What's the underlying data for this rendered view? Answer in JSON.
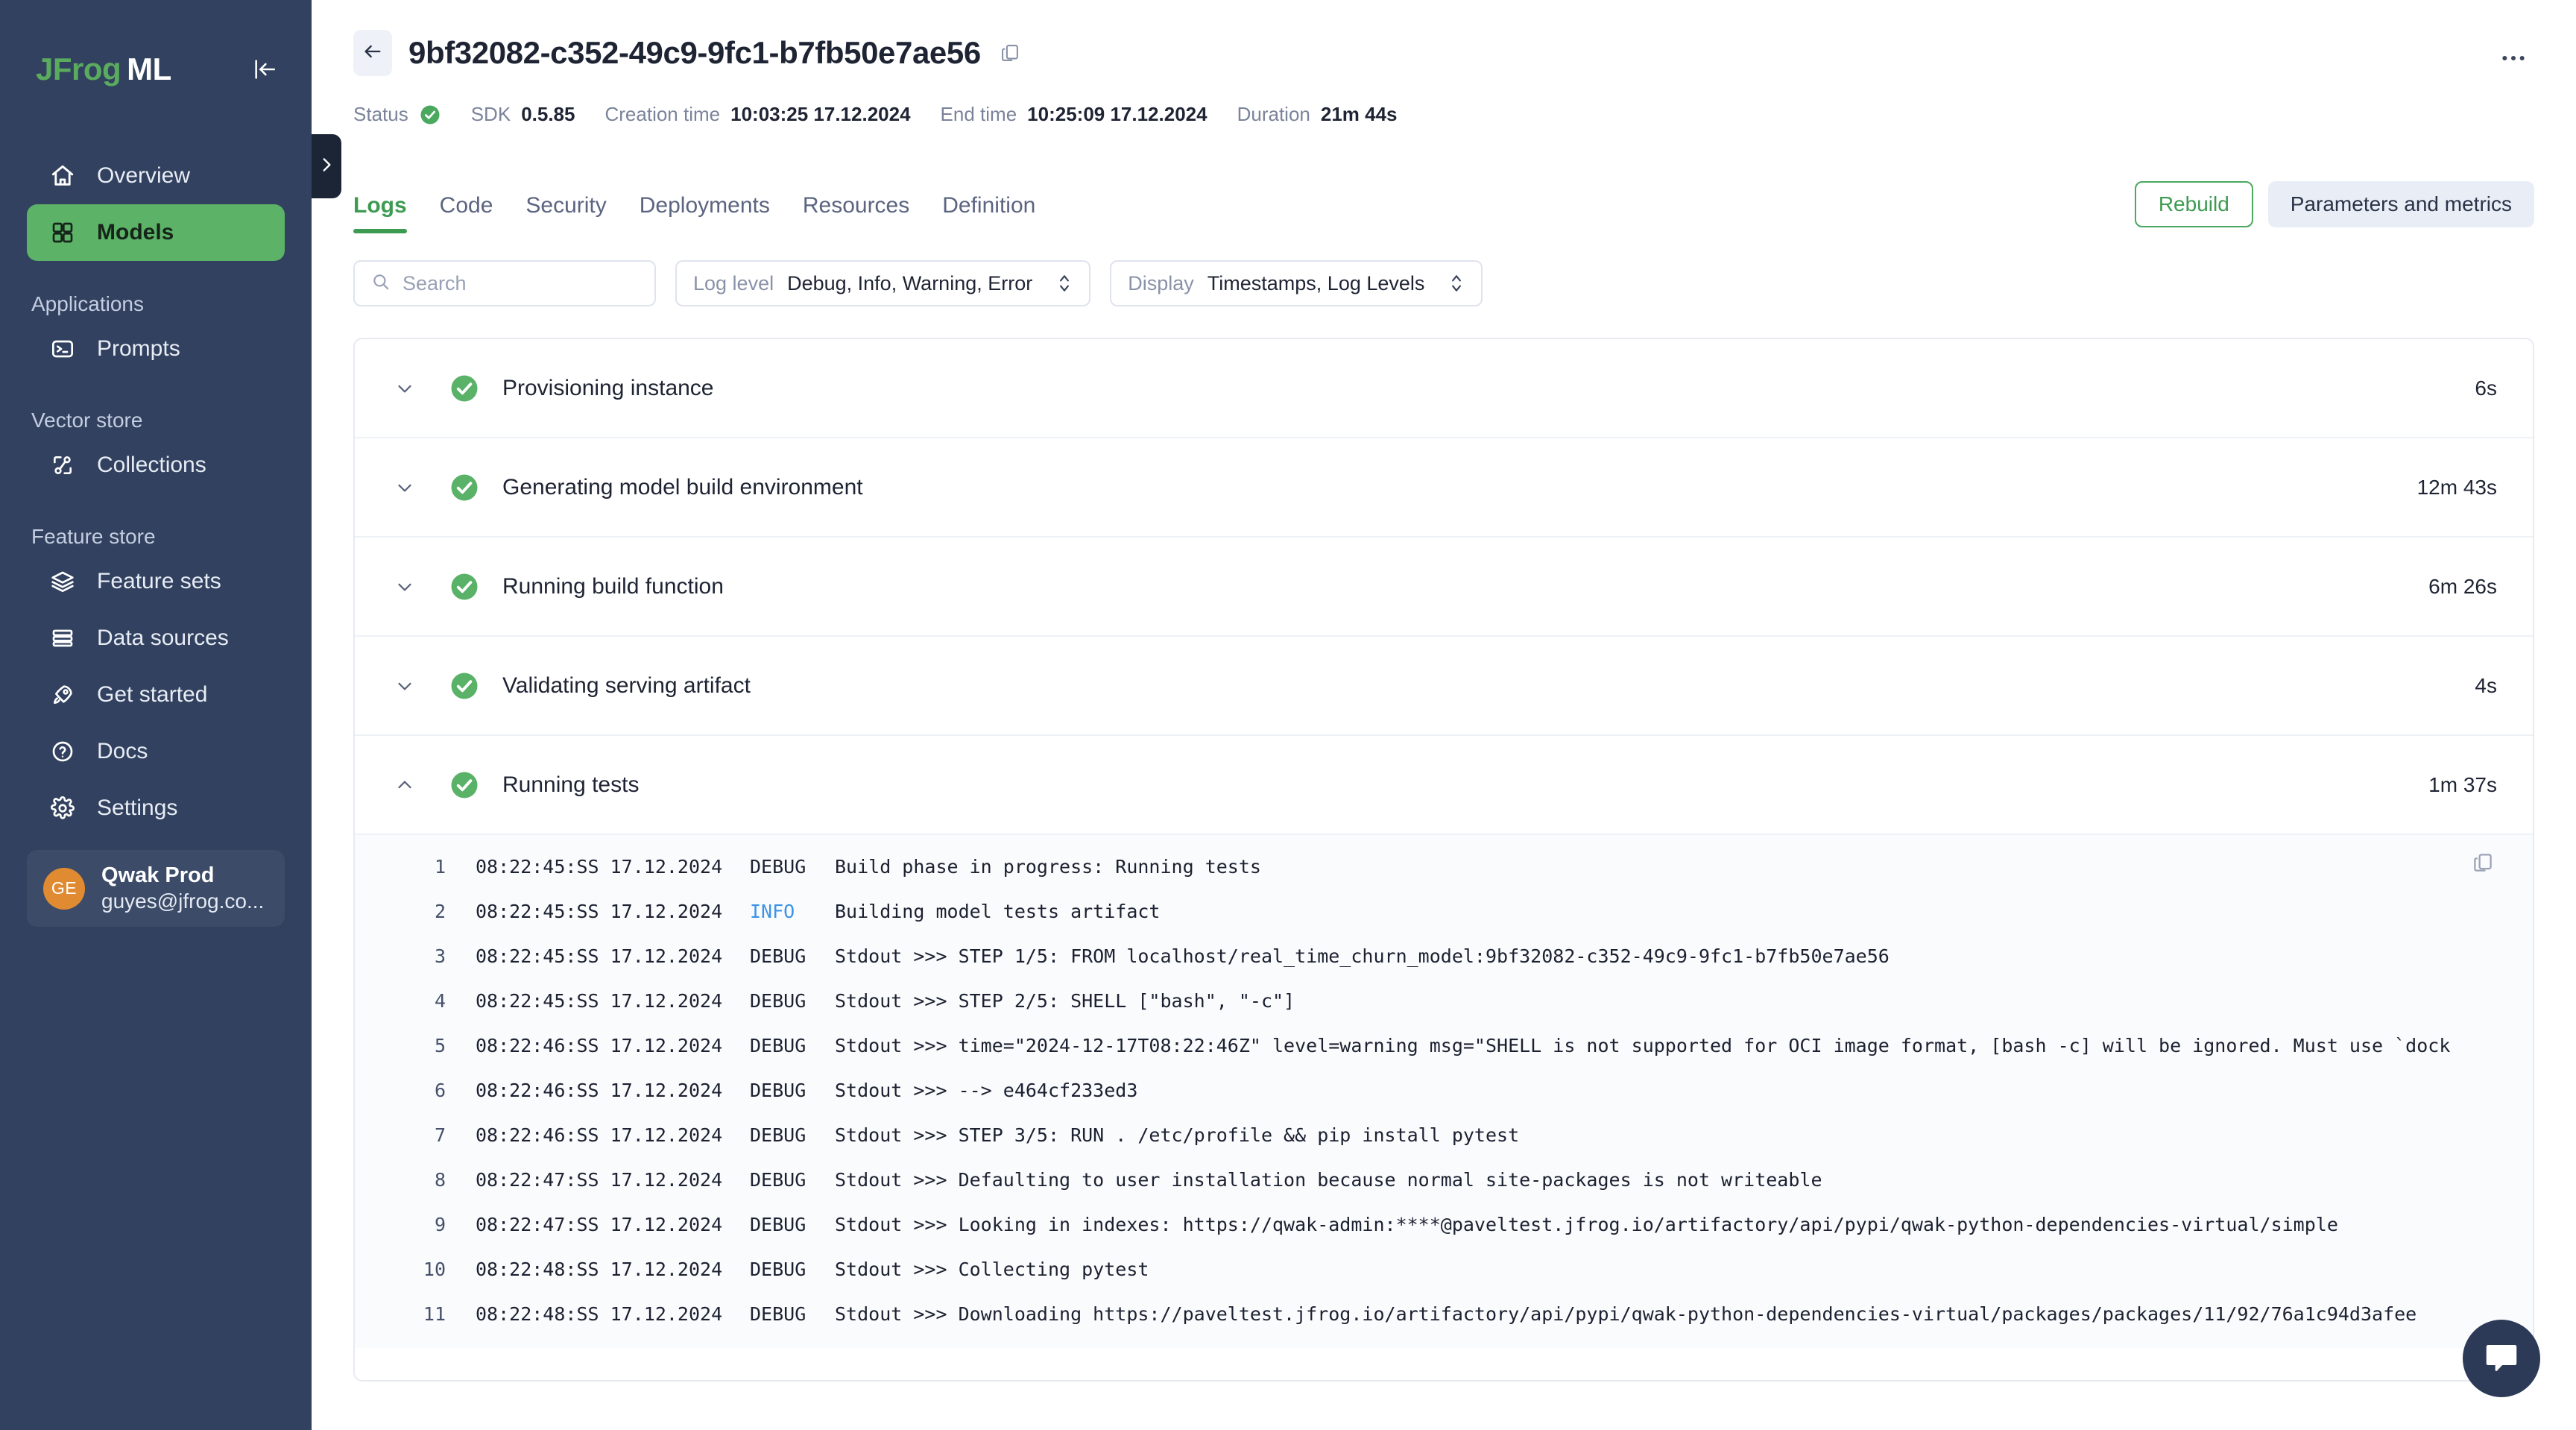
{
  "sidebar": {
    "brand": {
      "first": "JFrog",
      "second": "ML"
    },
    "collapse_icon": "collapse-panel-icon",
    "primary": [
      {
        "label": "Overview",
        "icon": "home-icon",
        "active": false
      },
      {
        "label": "Models",
        "icon": "grid-icon",
        "active": true
      }
    ],
    "groups": [
      {
        "title": "Applications",
        "items": [
          {
            "label": "Prompts",
            "icon": "terminal-icon"
          }
        ]
      },
      {
        "title": "Vector store",
        "items": [
          {
            "label": "Collections",
            "icon": "collections-icon"
          }
        ]
      },
      {
        "title": "Feature store",
        "items": [
          {
            "label": "Feature sets",
            "icon": "layers-icon"
          },
          {
            "label": "Data sources",
            "icon": "database-icon"
          }
        ]
      }
    ],
    "bottom": [
      {
        "label": "Get started",
        "icon": "rocket-icon"
      },
      {
        "label": "Docs",
        "icon": "question-circle-icon"
      },
      {
        "label": "Settings",
        "icon": "gear-icon"
      }
    ],
    "user": {
      "initials": "GE",
      "name": "Qwak Prod",
      "email": "guyes@jfrog.co...",
      "avatar_color": "#e08b32"
    },
    "edge_handle_icon": "chevron-right-icon"
  },
  "header": {
    "back_icon": "arrow-left-icon",
    "title": "9bf32082-c352-49c9-9fc1-b7fb50e7ae56",
    "copy_icon": "copy-icon",
    "more_icon": "more-horizontal-icon",
    "meta": [
      {
        "label": "Status",
        "value": "",
        "icon": "check-circle-icon"
      },
      {
        "label": "SDK",
        "value": "0.5.85"
      },
      {
        "label": "Creation time",
        "value": "10:03:25 17.12.2024"
      },
      {
        "label": "End time",
        "value": "10:25:09 17.12.2024"
      },
      {
        "label": "Duration",
        "value": "21m 44s"
      }
    ]
  },
  "tabs": [
    {
      "label": "Logs",
      "active": true
    },
    {
      "label": "Code",
      "active": false
    },
    {
      "label": "Security",
      "active": false
    },
    {
      "label": "Deployments",
      "active": false
    },
    {
      "label": "Resources",
      "active": false
    },
    {
      "label": "Definition",
      "active": false
    }
  ],
  "actions": {
    "rebuild": "Rebuild",
    "parameters_and_metrics": "Parameters and metrics"
  },
  "filters": {
    "search_placeholder": "Search",
    "search_value": "",
    "search_icon": "search-icon",
    "log_level": {
      "label": "Log level",
      "value": "Debug, Info, Warning, Error"
    },
    "display": {
      "label": "Display",
      "value": "Timestamps, Log Levels"
    }
  },
  "steps": [
    {
      "name": "Provisioning instance",
      "duration": "6s",
      "status": "success",
      "expanded": false
    },
    {
      "name": "Generating model build environment",
      "duration": "12m 43s",
      "status": "success",
      "expanded": false
    },
    {
      "name": "Running build function",
      "duration": "6m 26s",
      "status": "success",
      "expanded": false
    },
    {
      "name": "Validating serving artifact",
      "duration": "4s",
      "status": "success",
      "expanded": false
    },
    {
      "name": "Running tests",
      "duration": "1m 37s",
      "status": "success",
      "expanded": true
    }
  ],
  "log": {
    "copy_icon": "copy-icon",
    "lines": [
      {
        "n": "1",
        "ts": "08:22:45:SS 17.12.2024",
        "level": "DEBUG",
        "msg": "Build phase in progress: Running tests"
      },
      {
        "n": "2",
        "ts": "08:22:45:SS 17.12.2024",
        "level": "INFO",
        "msg": "Building model tests artifact"
      },
      {
        "n": "3",
        "ts": "08:22:45:SS 17.12.2024",
        "level": "DEBUG",
        "msg": "Stdout >>> STEP 1/5: FROM localhost/real_time_churn_model:9bf32082-c352-49c9-9fc1-b7fb50e7ae56"
      },
      {
        "n": "4",
        "ts": "08:22:45:SS 17.12.2024",
        "level": "DEBUG",
        "msg": "Stdout >>> STEP 2/5: SHELL [\"bash\", \"-c\"]"
      },
      {
        "n": "5",
        "ts": "08:22:46:SS 17.12.2024",
        "level": "DEBUG",
        "msg": "Stdout >>> time=\"2024-12-17T08:22:46Z\" level=warning msg=\"SHELL is not supported for OCI image format, [bash -c] will be ignored. Must use `dock"
      },
      {
        "n": "6",
        "ts": "08:22:46:SS 17.12.2024",
        "level": "DEBUG",
        "msg": "Stdout >>> --> e464cf233ed3"
      },
      {
        "n": "7",
        "ts": "08:22:46:SS 17.12.2024",
        "level": "DEBUG",
        "msg": "Stdout >>> STEP 3/5: RUN . /etc/profile && pip install pytest"
      },
      {
        "n": "8",
        "ts": "08:22:47:SS 17.12.2024",
        "level": "DEBUG",
        "msg": "Stdout >>> Defaulting to user installation because normal site-packages is not writeable"
      },
      {
        "n": "9",
        "ts": "08:22:47:SS 17.12.2024",
        "level": "DEBUG",
        "msg": "Stdout >>> Looking in indexes: https://qwak-admin:****@paveltest.jfrog.io/artifactory/api/pypi/qwak-python-dependencies-virtual/simple"
      },
      {
        "n": "10",
        "ts": "08:22:48:SS 17.12.2024",
        "level": "DEBUG",
        "msg": "Stdout >>> Collecting pytest"
      },
      {
        "n": "11",
        "ts": "08:22:48:SS 17.12.2024",
        "level": "DEBUG",
        "msg": "Stdout >>>   Downloading https://paveltest.jfrog.io/artifactory/api/pypi/qwak-python-dependencies-virtual/packages/packages/11/92/76a1c94d3afee"
      }
    ]
  },
  "chat": {
    "icon": "chat-bubble-icon"
  },
  "colors": {
    "sidebar_bg": "#31415f",
    "accent_green": "#5cb267",
    "brand_green": "#5aab5e",
    "info_blue": "#3b93e8",
    "avatar_orange": "#e08b32"
  }
}
